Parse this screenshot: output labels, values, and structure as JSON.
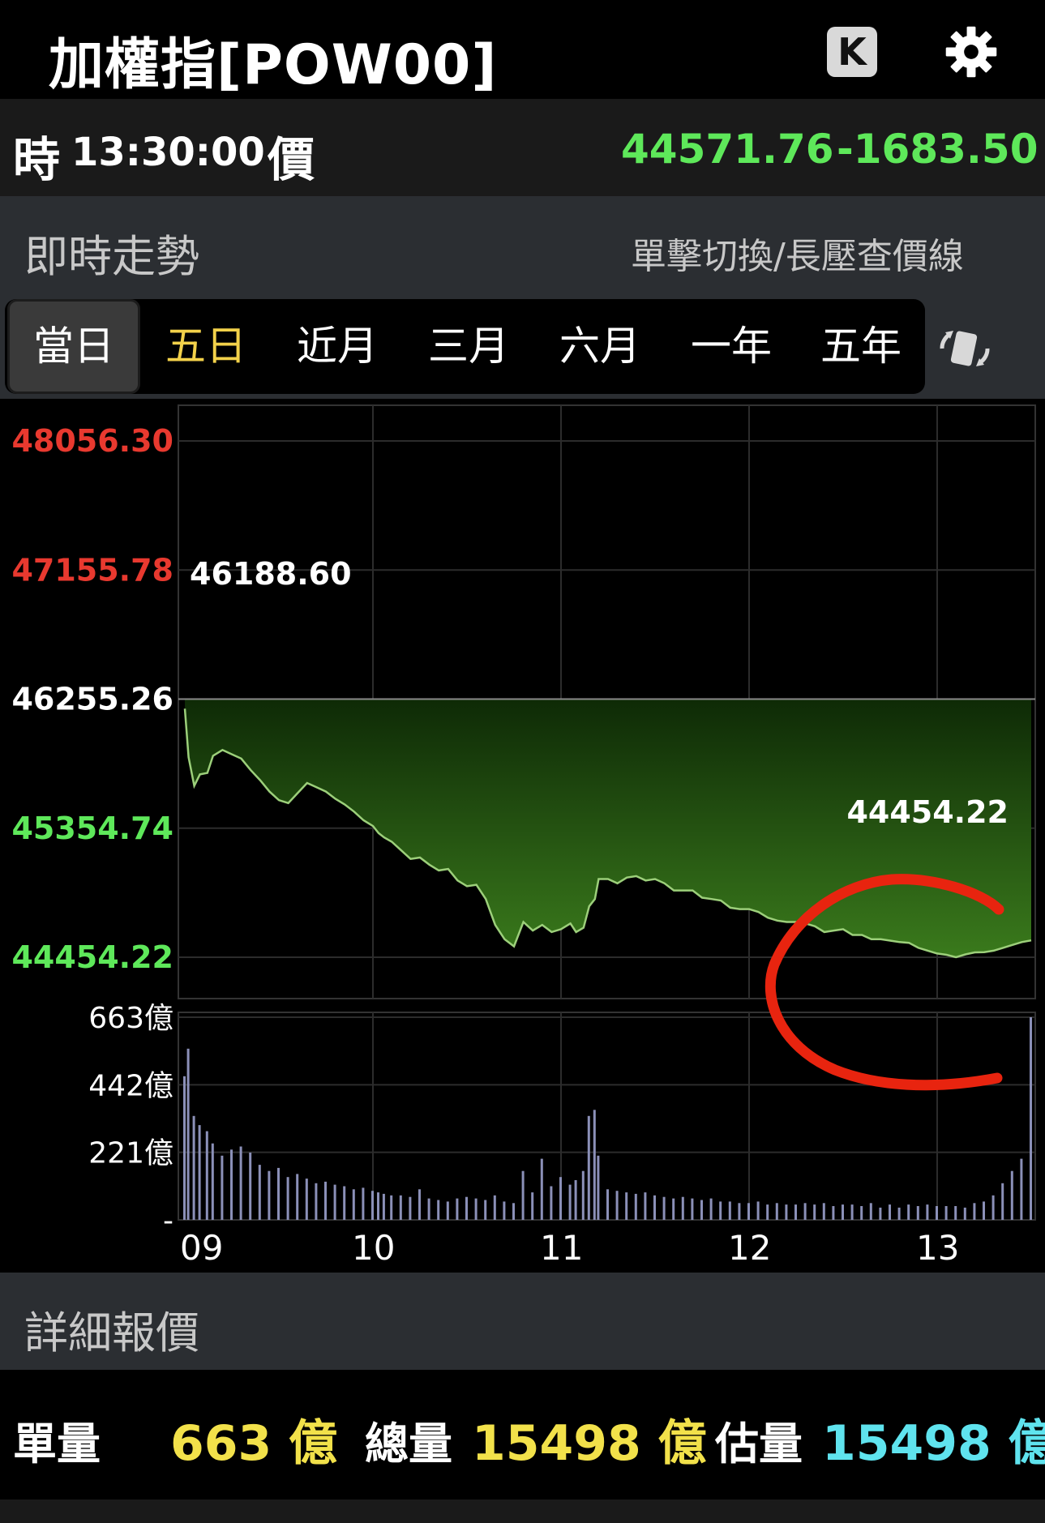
{
  "header": {
    "title": "加權指[POW00]",
    "k_label": "K"
  },
  "quote": {
    "time_label": "時",
    "time": "13:30:00",
    "price_label": "價",
    "price": "44571.76",
    "change": "-1683.50"
  },
  "section_live": {
    "title": "即時走勢",
    "hint": "單擊切換/長壓查價線"
  },
  "tabs": [
    {
      "label": "當日"
    },
    {
      "label": "五日"
    },
    {
      "label": "近月"
    },
    {
      "label": "三月"
    },
    {
      "label": "六月"
    },
    {
      "label": "一年"
    },
    {
      "label": "五年"
    }
  ],
  "colors": {
    "up": "#e8392f",
    "down": "#5ee85a",
    "neutral": "#ffffff",
    "yellow": "#f2d14a",
    "cyan": "#5fe3ee",
    "area_top": "#2f6a18",
    "annotation": "#e8240f"
  },
  "chart_data": {
    "type": "area",
    "price_axis": {
      "ticks": [
        {
          "value": 48056.3,
          "label": "48056.30",
          "color": "up"
        },
        {
          "value": 47155.78,
          "label": "47155.78",
          "color": "up"
        },
        {
          "value": 46255.26,
          "label": "46255.26",
          "color": "neutral"
        },
        {
          "value": 45354.74,
          "label": "45354.74",
          "color": "down"
        },
        {
          "value": 44454.22,
          "label": "44454.22",
          "color": "down"
        }
      ],
      "reference": 46255.26
    },
    "volume_axis": {
      "ticks": [
        "663億",
        "442億",
        "221億",
        "-"
      ],
      "max": 663
    },
    "time_axis": {
      "labels": [
        "09",
        "10",
        "11",
        "12",
        "13"
      ],
      "start_hour": 9,
      "end": 13.5
    },
    "high_label": "46188.60",
    "low_label": "44454.22",
    "series": {
      "t": [
        9.0,
        9.02,
        9.05,
        9.08,
        9.12,
        9.15,
        9.2,
        9.25,
        9.3,
        9.35,
        9.4,
        9.45,
        9.5,
        9.55,
        9.6,
        9.65,
        9.7,
        9.75,
        9.8,
        9.85,
        9.9,
        9.95,
        10.0,
        10.03,
        10.06,
        10.1,
        10.15,
        10.2,
        10.25,
        10.3,
        10.35,
        10.4,
        10.45,
        10.5,
        10.55,
        10.6,
        10.65,
        10.7,
        10.75,
        10.8,
        10.85,
        10.9,
        10.95,
        11.0,
        11.05,
        11.08,
        11.12,
        11.15,
        11.18,
        11.2,
        11.25,
        11.3,
        11.35,
        11.4,
        11.45,
        11.5,
        11.55,
        11.6,
        11.65,
        11.7,
        11.75,
        11.8,
        11.85,
        11.9,
        11.95,
        12.0,
        12.05,
        12.1,
        12.15,
        12.2,
        12.25,
        12.3,
        12.35,
        12.4,
        12.45,
        12.5,
        12.55,
        12.6,
        12.65,
        12.7,
        12.75,
        12.8,
        12.85,
        12.9,
        12.95,
        13.0,
        13.05,
        13.1,
        13.15,
        13.2,
        13.25,
        13.3,
        13.35,
        13.4,
        13.45,
        13.5
      ],
      "price": [
        46188.6,
        45850,
        45650,
        45730,
        45740,
        45860,
        45900,
        45870,
        45840,
        45760,
        45690,
        45610,
        45550,
        45530,
        45600,
        45670,
        45640,
        45610,
        45560,
        45520,
        45470,
        45410,
        45370,
        45320,
        45290,
        45260,
        45200,
        45140,
        45150,
        45100,
        45060,
        45070,
        44990,
        44950,
        44960,
        44860,
        44680,
        44580,
        44530,
        44700,
        44640,
        44680,
        44630,
        44650,
        44690,
        44630,
        44660,
        44810,
        44860,
        45000,
        45000,
        44970,
        45010,
        45020,
        44990,
        45000,
        44970,
        44920,
        44920,
        44920,
        44870,
        44860,
        44850,
        44800,
        44790,
        44790,
        44770,
        44730,
        44710,
        44700,
        44700,
        44690,
        44670,
        44630,
        44640,
        44650,
        44610,
        44610,
        44580,
        44580,
        44570,
        44560,
        44555,
        44520,
        44500,
        44480,
        44471,
        44454.22,
        44474,
        44488,
        44490,
        44500,
        44520,
        44540,
        44560,
        44571.76
      ],
      "volume": [
        470,
        560,
        340,
        310,
        290,
        250,
        210,
        230,
        240,
        220,
        180,
        160,
        170,
        140,
        150,
        135,
        120,
        125,
        115,
        110,
        100,
        105,
        95,
        90,
        85,
        80,
        80,
        75,
        100,
        70,
        65,
        60,
        70,
        75,
        70,
        65,
        80,
        60,
        55,
        160,
        90,
        200,
        110,
        140,
        115,
        130,
        160,
        340,
        360,
        210,
        100,
        95,
        90,
        85,
        90,
        80,
        75,
        70,
        75,
        70,
        65,
        70,
        60,
        60,
        55,
        55,
        60,
        50,
        55,
        50,
        50,
        55,
        50,
        55,
        45,
        50,
        50,
        45,
        55,
        40,
        50,
        40,
        50,
        45,
        50,
        45,
        45,
        45,
        40,
        55,
        60,
        80,
        120,
        160,
        200,
        663
      ]
    }
  }
}
